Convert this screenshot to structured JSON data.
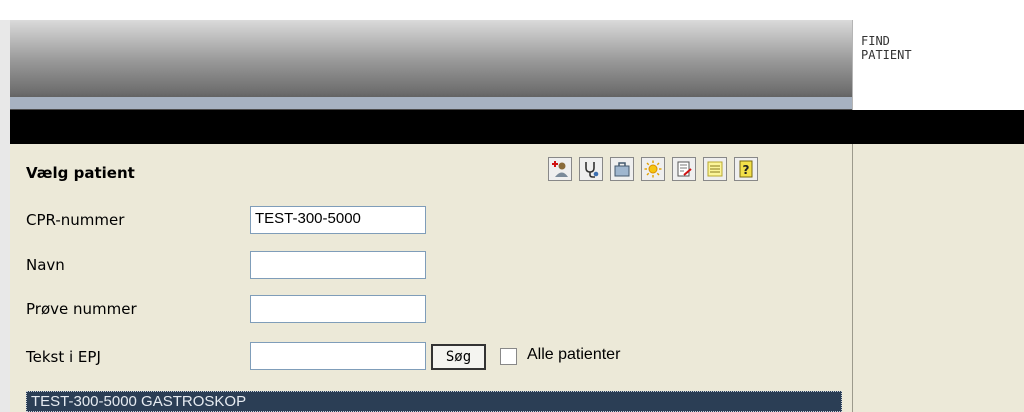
{
  "tab": {
    "label": "FIND\nPATIENT"
  },
  "panel": {
    "title": "Vælg patient",
    "toolbar_icons": [
      "add-patient-icon",
      "stethoscope-icon",
      "bag-icon",
      "sun-icon",
      "edit-document-icon",
      "list-icon",
      "help-icon"
    ],
    "fields": [
      {
        "label": "CPR-nummer",
        "value": "TEST-300-5000"
      },
      {
        "label": "Navn",
        "value": ""
      },
      {
        "label": "Prøve nummer",
        "value": ""
      },
      {
        "label": "Tekst i EPJ",
        "value": ""
      }
    ],
    "search_label": "Søg",
    "all_patients_label": "Alle patienter",
    "all_patients_checked": false,
    "results": [
      "TEST-300-5000 GASTROSKOP"
    ]
  },
  "colors": {
    "header_strip": "#a7b2c1",
    "panel_bg": "#ece9d8",
    "selection": "#2b3e55"
  }
}
